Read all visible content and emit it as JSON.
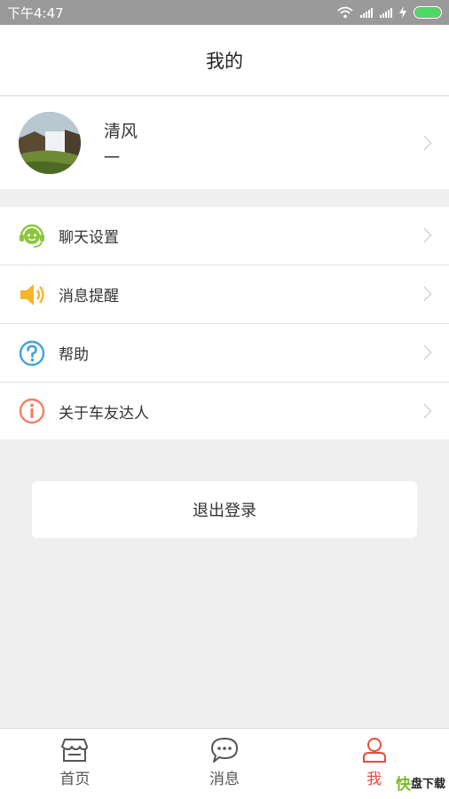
{
  "status": {
    "time": "下午4:47",
    "icons": [
      "wifi-icon",
      "signal-icon",
      "signal-icon",
      "charging-icon",
      "battery-icon"
    ],
    "battery_color": "#4cd964"
  },
  "header": {
    "title": "我的"
  },
  "profile": {
    "name": "清风",
    "subtitle": "一"
  },
  "menu": {
    "items": [
      {
        "label": "聊天设置",
        "icon": "chat-support-icon",
        "color": "#8cc63f"
      },
      {
        "label": "消息提醒",
        "icon": "speaker-icon",
        "color": "#f5b62a"
      },
      {
        "label": "帮助",
        "icon": "help-icon",
        "color": "#3fa2e0"
      },
      {
        "label": "关于车友达人",
        "icon": "info-icon",
        "color": "#f08060"
      }
    ]
  },
  "logout": {
    "label": "退出登录"
  },
  "tabbar": {
    "tabs": [
      {
        "label": "首页",
        "icon": "store-icon"
      },
      {
        "label": "消息",
        "icon": "message-icon"
      },
      {
        "label": "我",
        "icon": "person-icon",
        "active": true
      }
    ],
    "active_color": "#e84a3c"
  },
  "watermark": {
    "k": "快",
    "text": "盘下载"
  }
}
